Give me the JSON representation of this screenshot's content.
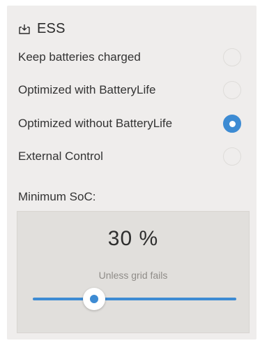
{
  "header": {
    "title": "ESS",
    "icon": "battery-in-icon"
  },
  "options": [
    {
      "label": "Keep batteries charged",
      "selected": false
    },
    {
      "label": "Optimized with BatteryLife",
      "selected": false
    },
    {
      "label": "Optimized without BatteryLife",
      "selected": true
    },
    {
      "label": "External Control",
      "selected": false
    }
  ],
  "min_soc": {
    "label": "Minimum SoC:",
    "value_text": "30 %",
    "subtitle": "Unless grid fails",
    "fraction": 0.3
  },
  "colors": {
    "accent": "#3d8bd3",
    "panel": "#efedec",
    "box": "#e1dfdc"
  }
}
